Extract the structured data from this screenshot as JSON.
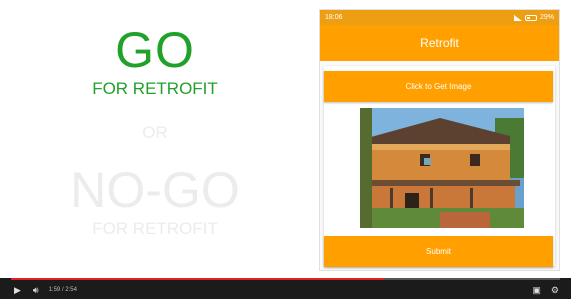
{
  "slide": {
    "go": "GO",
    "go_sub": "FOR RETROFIT",
    "or": "OR",
    "nogo": "NO-GO",
    "nogo_sub": "FOR RETROFIT",
    "colors": {
      "go": "#1fa12a",
      "faded": "#ececec"
    }
  },
  "phone": {
    "status_time": "18:06",
    "status_battery": "29%",
    "app_title": "Retrofit",
    "get_image_label": "Click to Get Image",
    "submit_label": "Submit",
    "accent": "#ffa000"
  },
  "player": {
    "time": "1:59 / 2:54",
    "progress_fraction": 0.68
  }
}
